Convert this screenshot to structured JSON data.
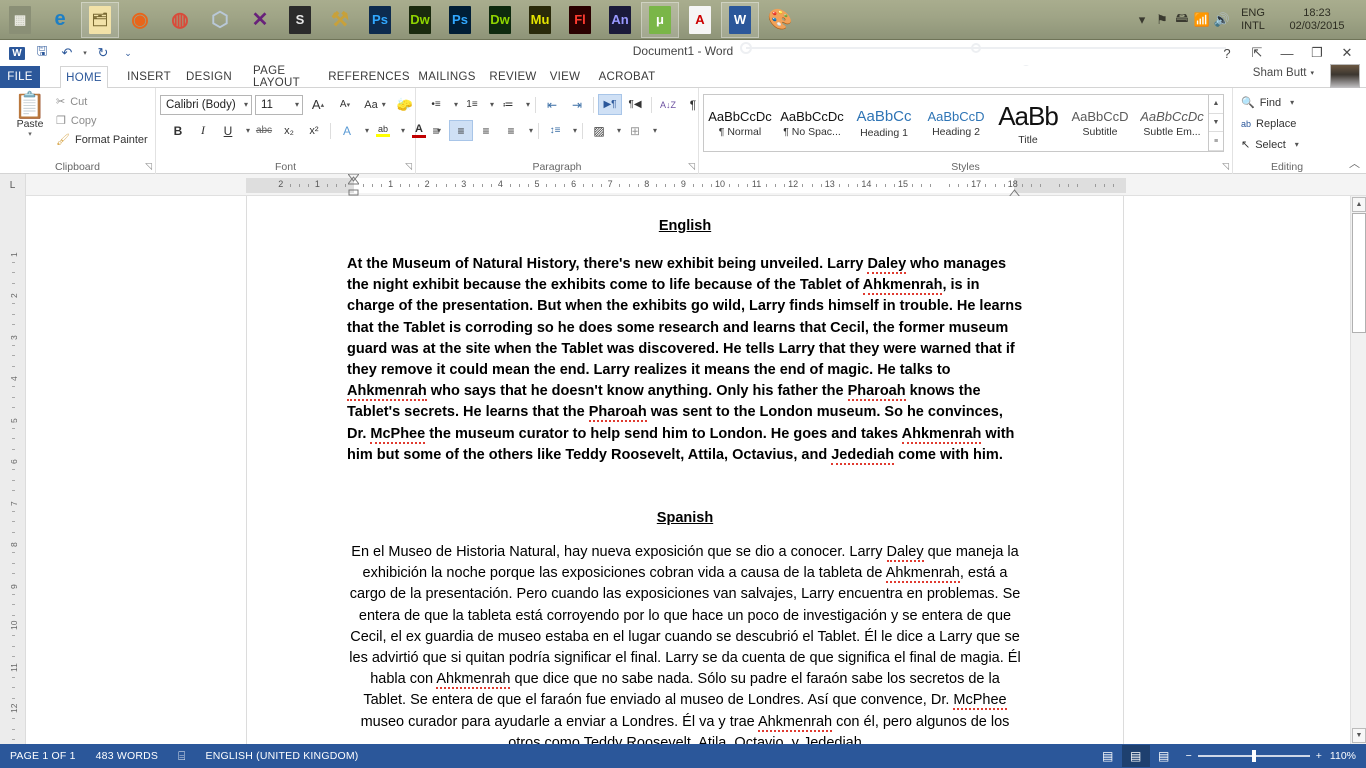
{
  "taskbar": {
    "apps": [
      {
        "name": "start-menu-icon",
        "glyph": "▦",
        "bg": "#8a8f76",
        "fg": "#e8e8e0"
      },
      {
        "name": "internet-explorer-icon",
        "glyph": "e",
        "bg": "transparent",
        "fg": "#1e7fc4"
      },
      {
        "name": "file-explorer-icon",
        "glyph": "🗂",
        "bg": "#f2e2a8",
        "fg": "#7a6a32"
      },
      {
        "name": "firefox-icon",
        "glyph": "◉",
        "bg": "transparent",
        "fg": "#e8651a"
      },
      {
        "name": "chrome-icon",
        "glyph": "◍",
        "bg": "transparent",
        "fg": "#d94b3a"
      },
      {
        "name": "cube-3d-icon",
        "glyph": "⬡",
        "bg": "transparent",
        "fg": "#b9c8d8"
      },
      {
        "name": "visual-studio-icon",
        "glyph": "✕",
        "bg": "transparent",
        "fg": "#68217a"
      },
      {
        "name": "sublime-text-icon",
        "glyph": "S",
        "bg": "#2b2b2b",
        "fg": "#e8e8e8"
      },
      {
        "name": "tools-icon",
        "glyph": "⚒",
        "bg": "transparent",
        "fg": "#c8a13a"
      },
      {
        "name": "photoshop-icon",
        "glyph": "Ps",
        "bg": "#0d2b4e",
        "fg": "#31a8ff"
      },
      {
        "name": "dreamweaver-icon",
        "glyph": "Dw",
        "bg": "#1a2a0e",
        "fg": "#8fd400"
      },
      {
        "name": "photoshop-cc-icon",
        "glyph": "Ps",
        "bg": "#001e36",
        "fg": "#31a8ff"
      },
      {
        "name": "dreamweaver-cc-icon",
        "glyph": "Dw",
        "bg": "#0e2a0e",
        "fg": "#8fd400"
      },
      {
        "name": "muse-icon",
        "glyph": "Mu",
        "bg": "#2a2a0a",
        "fg": "#e6e600"
      },
      {
        "name": "flash-icon",
        "glyph": "Fl",
        "bg": "#2a0000",
        "fg": "#ff3b30"
      },
      {
        "name": "animate-icon",
        "glyph": "An",
        "bg": "#1a1a3a",
        "fg": "#9999ff"
      },
      {
        "name": "utorrent-icon",
        "glyph": "μ",
        "bg": "#7ab648",
        "fg": "#ffffff"
      },
      {
        "name": "adobe-reader-icon",
        "glyph": "A",
        "bg": "#f5f5f5",
        "fg": "#cc0000"
      },
      {
        "name": "word-taskbar-icon",
        "glyph": "W",
        "bg": "#2b579a",
        "fg": "#ffffff"
      },
      {
        "name": "paint-icon",
        "glyph": "🎨",
        "bg": "transparent",
        "fg": "#d8a84e"
      }
    ],
    "tray": {
      "expand_icon": "▾",
      "icons": [
        "flag-icon",
        "usb-device-icon",
        "network-signal-icon",
        "volume-icon"
      ],
      "language_line1": "ENG",
      "language_line2": "INTL",
      "time": "18:23",
      "date": "02/03/2015"
    }
  },
  "window": {
    "title": "Document1 - Word",
    "quick_access": [
      {
        "name": "word-logo-icon",
        "glyph": "W"
      },
      {
        "name": "save-icon",
        "glyph": "🖫"
      },
      {
        "name": "undo-icon",
        "glyph": "↶"
      },
      {
        "name": "redo-icon",
        "glyph": "↻"
      },
      {
        "name": "customize-qat-icon",
        "glyph": "⌄"
      }
    ],
    "controls": [
      {
        "name": "help-button",
        "glyph": "?"
      },
      {
        "name": "ribbon-display-options-button",
        "glyph": "⇱"
      },
      {
        "name": "minimize-button",
        "glyph": "—"
      },
      {
        "name": "restore-button",
        "glyph": "❐"
      },
      {
        "name": "close-button",
        "glyph": "✕"
      }
    ],
    "account_name": "Sham Butt",
    "account_caret": "▾"
  },
  "tabs": [
    {
      "label": "FILE",
      "name": "tab-file"
    },
    {
      "label": "HOME",
      "name": "tab-home"
    },
    {
      "label": "INSERT",
      "name": "tab-insert"
    },
    {
      "label": "DESIGN",
      "name": "tab-design"
    },
    {
      "label": "PAGE LAYOUT",
      "name": "tab-page-layout"
    },
    {
      "label": "REFERENCES",
      "name": "tab-references"
    },
    {
      "label": "MAILINGS",
      "name": "tab-mailings"
    },
    {
      "label": "REVIEW",
      "name": "tab-review"
    },
    {
      "label": "VIEW",
      "name": "tab-view"
    },
    {
      "label": "ACROBAT",
      "name": "tab-acrobat"
    }
  ],
  "ribbon": {
    "clipboard": {
      "group_label": "Clipboard",
      "paste_label": "Paste",
      "cut_label": "Cut",
      "copy_label": "Copy",
      "format_painter_label": "Format Painter"
    },
    "font": {
      "group_label": "Font",
      "font_name": "Calibri (Body)",
      "font_size": "11",
      "grow_font": "A",
      "shrink_font": "A",
      "change_case": "Aa",
      "clear_formatting": "A",
      "bold": "B",
      "italic": "I",
      "underline": "U",
      "strikethrough": "abc",
      "subscript": "x₂",
      "superscript": "x²",
      "text_effects": "A",
      "highlight": "ab",
      "font_color": "A"
    },
    "paragraph": {
      "group_label": "Paragraph",
      "bullets": "•≡",
      "numbering": "1≡",
      "multilevel": "≔",
      "decrease_indent": "⇤",
      "increase_indent": "⇥",
      "ltr": "▶¶",
      "rtl": "¶◀",
      "sort": "A↓Z",
      "show_marks": "¶",
      "align_left": "≡",
      "align_center": "≡",
      "align_right": "≡",
      "justify": "≡",
      "line_spacing": "↕≡",
      "shading": "▨",
      "borders": "⊞"
    },
    "styles": {
      "group_label": "Styles",
      "items": [
        {
          "preview": "AaBbCcDc",
          "name": "¶ Normal",
          "color": "#111"
        },
        {
          "preview": "AaBbCcDc",
          "name": "¶ No Spac...",
          "color": "#111"
        },
        {
          "preview": "AaBbCc",
          "name": "Heading 1",
          "color": "#2e74b5"
        },
        {
          "preview": "AaBbCcD",
          "name": "Heading 2",
          "color": "#2e74b5"
        },
        {
          "preview": "AaBb",
          "name": "Title",
          "color": "#111"
        },
        {
          "preview": "AaBbCcD",
          "name": "Subtitle",
          "color": "#5a5a5a"
        },
        {
          "preview": "AaBbCcDc",
          "name": "Subtle Em...",
          "color": "#5a5a5a"
        }
      ],
      "scroll_up": "▲",
      "scroll_down": "▼",
      "more": "▾"
    },
    "editing": {
      "group_label": "Editing",
      "find_label": "Find",
      "replace_label": "Replace",
      "select_label": "Select"
    },
    "collapse_ribbon": "︿"
  },
  "ruler": {
    "horizontal_numbers": [
      "2",
      "1",
      "1",
      "2",
      "3",
      "4",
      "5",
      "6",
      "7",
      "8",
      "9",
      "10",
      "11",
      "12",
      "13",
      "14",
      "15",
      "17",
      "18"
    ],
    "vertical_numbers": [
      "1",
      "2",
      "3",
      "4",
      "5",
      "6",
      "7",
      "8",
      "9",
      "10",
      "11",
      "12"
    ],
    "tab_stop_marker": "L"
  },
  "document": {
    "heading_english": "English",
    "paragraph_english": "At the Museum of Natural History, there's new exhibit being unveiled. Larry Daley who manages the night exhibit because the exhibits come to life because of the Tablet of Ahkmenrah, is in charge of the presentation. But when the exhibits go wild, Larry finds himself in trouble. He learns that the Tablet is corroding so he does some research and learns that Cecil, the former museum guard was at the site when the Tablet was discovered. He tells Larry that they were warned that if they remove it could mean the end. Larry realizes it means the end of magic. He talks to Ahkmenrah who says that he doesn't know anything. Only his father the Pharoah knows the Tablet's secrets. He learns that the Pharoah was sent to the London museum. So he convinces, Dr. McPhee the museum curator to help send him to London. He goes and takes Ahkmenrah with him but some of the others like Teddy Roosevelt, Attila, Octavius, and Jedediah come with him.",
    "heading_spanish": "Spanish",
    "paragraph_spanish": "En el Museo de Historia Natural, hay nueva exposición que se dio a conocer. Larry Daley que maneja la exhibición la noche porque las exposiciones cobran vida a causa de la tableta de Ahkmenrah, está a cargo de la presentación. Pero cuando las exposiciones van salvajes, Larry encuentra en problemas. Se entera de que la tableta está corroyendo por lo que hace un poco de investigación y se entera de que Cecil, el ex guardia de museo estaba en el lugar cuando se descubrió el Tablet. Él le dice a Larry que se les advirtió que si quitan podría significar el final. Larry se da cuenta de que significa el final de magia. Él habla con Ahkmenrah que dice que no sabe nada. Sólo su padre el faraón sabe los secretos de la Tablet. Se entera de que el faraón fue enviado al museo de Londres. Así que convence, Dr. McPhee museo curador para ayudarle a enviar a Londres. Él va y trae Ahkmenrah con él, pero algunos de los otros como Teddy Roosevelt, Atila, Octavio, y Jedediah"
  },
  "status_bar": {
    "page": "PAGE 1 OF 1",
    "words": "483 WORDS",
    "proofing_icon": "spelling-check-icon",
    "language": "ENGLISH (UNITED KINGDOM)",
    "views": [
      {
        "name": "read-mode-button",
        "glyph": "▤",
        "active": false
      },
      {
        "name": "print-layout-button",
        "glyph": "▤",
        "active": true
      },
      {
        "name": "web-layout-button",
        "glyph": "▤",
        "active": false
      }
    ],
    "zoom_out": "−",
    "zoom_in": "+",
    "zoom_level": "110%"
  },
  "colors": {
    "word_blue": "#2b579a",
    "ribbon_accent": "#2e74b5",
    "taskbar": "#9fa486",
    "spellcheck_red": "#e03a2f"
  }
}
